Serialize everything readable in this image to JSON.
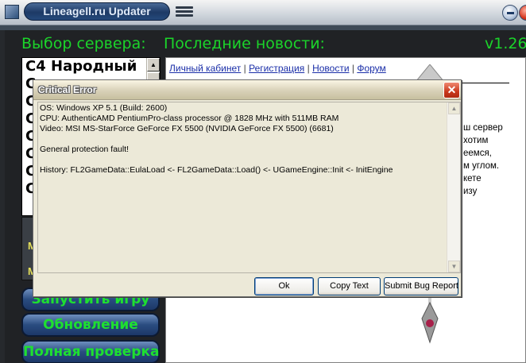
{
  "app": {
    "title": "Lineagell.ru Updater",
    "version": "v1.26"
  },
  "headers": {
    "servers": "Выбор сервера:",
    "news": "Последние новости:"
  },
  "servers": [
    "C4 Народный",
    "C",
    "C",
    "C",
    "C",
    "C",
    "C",
    "C"
  ],
  "infobox_letters": [
    "M",
    "M"
  ],
  "left_buttons": [
    {
      "label": "Запустить игру"
    },
    {
      "label": "Обновление"
    },
    {
      "label": "Полная проверка"
    }
  ],
  "news": {
    "links": [
      "Личный кабинет",
      "Регистрация",
      "Новости",
      "Форум"
    ],
    "separator": "|",
    "fragments": [
      "ш сервер",
      "хотим",
      "еемся,",
      "м углом.",
      "кете",
      "изу"
    ]
  },
  "dialog": {
    "title": "Critical Error",
    "close": "✕",
    "lines": [
      "OS: Windows XP 5.1 (Build: 2600)",
      "CPU: AuthenticAMD PentiumPro-class processor @ 1828 MHz with 511MB RAM",
      "Video: MSI MS-StarForce GeForce FX 5500 (NVIDIA GeForce FX 5500) (6681)",
      "",
      "General protection fault!",
      "",
      "History: FL2GameData::EulaLoad <- FL2GameData::Load() <- UGameEngine::Init <- InitEngine"
    ],
    "buttons": {
      "ok": "Ok",
      "copy": "Copy Text",
      "bug": "Submit Bug Report"
    }
  }
}
